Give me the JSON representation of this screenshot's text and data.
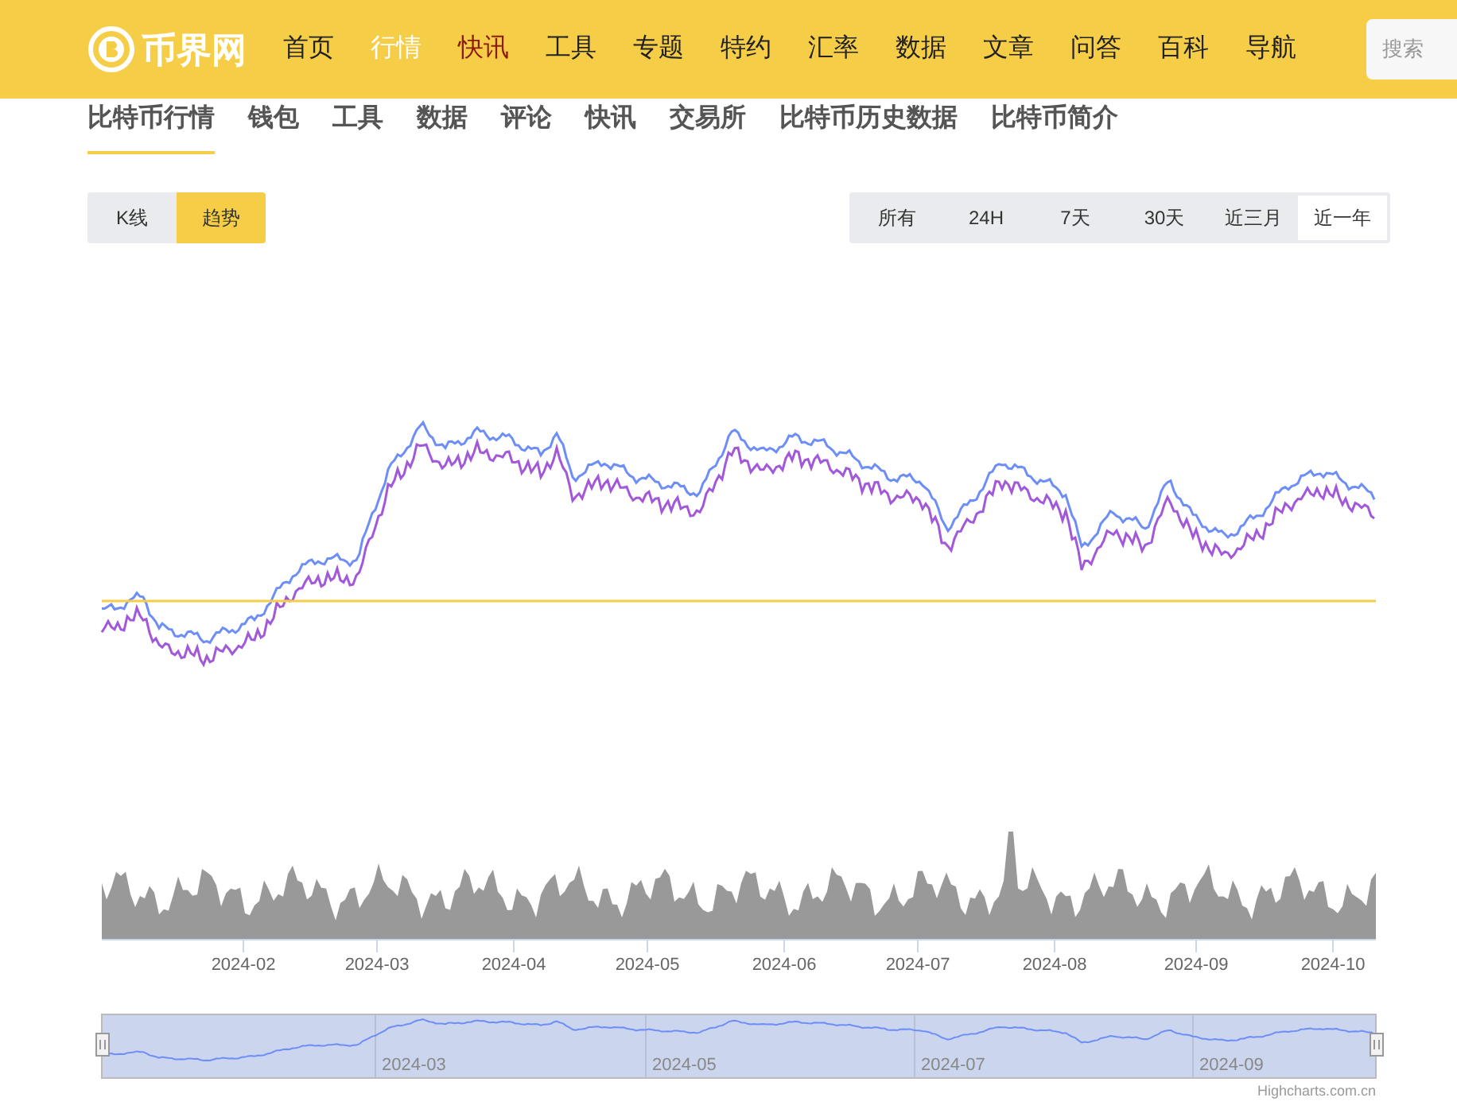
{
  "header": {
    "logo": "币界网",
    "nav": [
      {
        "label": "首页",
        "selected": false,
        "hot": false
      },
      {
        "label": "行情",
        "selected": true,
        "hot": false
      },
      {
        "label": "快讯",
        "selected": false,
        "hot": true
      },
      {
        "label": "工具",
        "selected": false,
        "hot": false
      },
      {
        "label": "专题",
        "selected": false,
        "hot": false
      },
      {
        "label": "特约",
        "selected": false,
        "hot": false
      },
      {
        "label": "汇率",
        "selected": false,
        "hot": false
      },
      {
        "label": "数据",
        "selected": false,
        "hot": false
      },
      {
        "label": "文章",
        "selected": false,
        "hot": false
      },
      {
        "label": "问答",
        "selected": false,
        "hot": false
      },
      {
        "label": "百科",
        "selected": false,
        "hot": false
      },
      {
        "label": "导航",
        "selected": false,
        "hot": false
      }
    ],
    "search": {
      "placeholder": "搜索"
    }
  },
  "subnav": [
    {
      "label": "比特币行情",
      "selected": true
    },
    {
      "label": "钱包",
      "selected": false
    },
    {
      "label": "工具",
      "selected": false
    },
    {
      "label": "数据",
      "selected": false
    },
    {
      "label": "评论",
      "selected": false
    },
    {
      "label": "快讯",
      "selected": false
    },
    {
      "label": "交易所",
      "selected": false
    },
    {
      "label": "比特币历史数据",
      "selected": false
    },
    {
      "label": "比特币简介",
      "selected": false
    }
  ],
  "chart_type_toggle": [
    {
      "label": "K线",
      "selected": false
    },
    {
      "label": "趋势",
      "selected": true
    }
  ],
  "range_buttons": [
    {
      "label": "所有",
      "selected": false
    },
    {
      "label": "24H",
      "selected": false
    },
    {
      "label": "7天",
      "selected": false
    },
    {
      "label": "30天",
      "selected": false
    },
    {
      "label": "近三月",
      "selected": false
    },
    {
      "label": "近一年",
      "selected": true
    }
  ],
  "chart": {
    "x_axis_labels": [
      "2024-02",
      "2024-03",
      "2024-04",
      "2024-05",
      "2024-06",
      "2024-07",
      "2024-08",
      "2024-09",
      "2024-10"
    ],
    "navigator_labels": [
      "2024-03",
      "2024-05",
      "2024-07",
      "2024-09"
    ],
    "credit": "Highcharts.com.cn"
  }
}
